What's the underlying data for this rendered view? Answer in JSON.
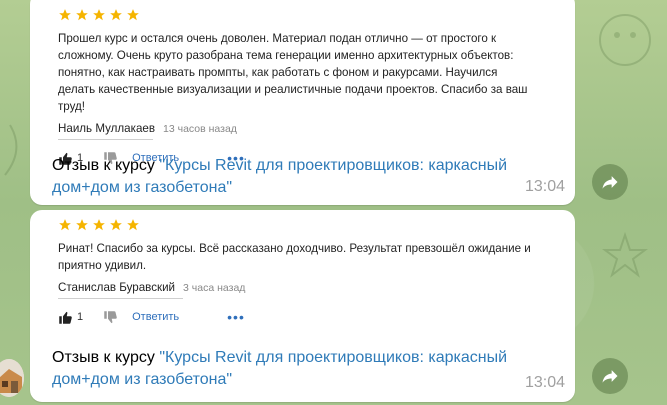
{
  "messages": [
    {
      "review": {
        "rating": 5,
        "text": "Прошел курс и остался очень доволен. Материал подан отлично — от простого к сложному. Очень круто разобрана тема генерации именно архитектурных объектов: понятно, как настраивать промпты, как работать с фоном и ракурсами. Научился делать качественные визуализации и реалистичные подачи проектов. Спасибо за ваш труд!",
        "author": "Наиль Муллакаев",
        "time_ago": "13 часов назад",
        "likes": "1",
        "reply_label": "Ответить",
        "more_label": "•••"
      },
      "caption_prefix": "Отзыв к курсу ",
      "caption_link": "\"Курсы Revit для проектировщиков: каркасный дом+дом из газобетона\"",
      "time": "13:04"
    },
    {
      "review": {
        "rating": 5,
        "text": "Ринат! Спасибо за курсы. Всё рассказано доходчиво. Результат превзошёл ожидание и приятно удивил.",
        "author": "Станислав Буравский",
        "time_ago": "3 часа назад",
        "likes": "1",
        "reply_label": "Ответить",
        "more_label": "•••"
      },
      "caption_prefix": "Отзыв к курсу ",
      "caption_link": "\"Курсы Revit для проектировщиков: каркасный дом+дом из газобетона\"",
      "time": "13:04"
    }
  ],
  "colors": {
    "star": "#f5b400",
    "link": "#2f7bb8",
    "chat_background": "#a9c58f"
  },
  "icons": {
    "like": "thumbs-up-icon",
    "dislike": "thumbs-down-icon",
    "share": "share-arrow-icon"
  }
}
